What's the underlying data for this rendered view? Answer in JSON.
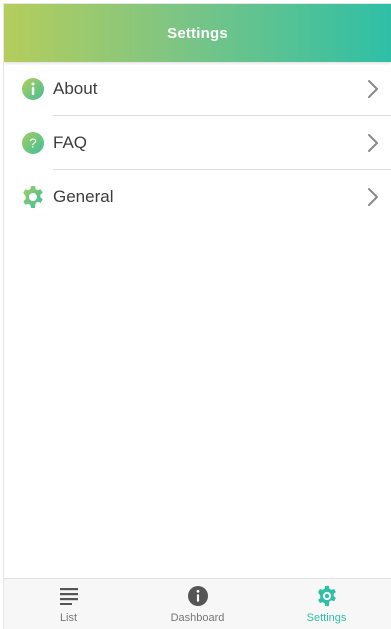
{
  "header": {
    "title": "Settings"
  },
  "settings_list": [
    {
      "label": "About",
      "icon": "info-circle-icon"
    },
    {
      "label": "FAQ",
      "icon": "question-circle-icon"
    },
    {
      "label": "General",
      "icon": "gear-icon"
    }
  ],
  "tabbar": {
    "tabs": [
      {
        "label": "List",
        "icon": "list-icon",
        "active": false
      },
      {
        "label": "Dashboard",
        "icon": "info-circle-icon",
        "active": false
      },
      {
        "label": "Settings",
        "icon": "gear-icon",
        "active": true
      }
    ]
  },
  "colors": {
    "accent": "#2fbfa6",
    "gradient_start": "#b5cd5c",
    "gradient_end": "#2fbfa6",
    "icon_gradient_a": "#a9cc5e",
    "icon_gradient_b": "#3dbf9f",
    "tab_inactive": "#777777",
    "tab_icon_inactive": "#555555"
  }
}
